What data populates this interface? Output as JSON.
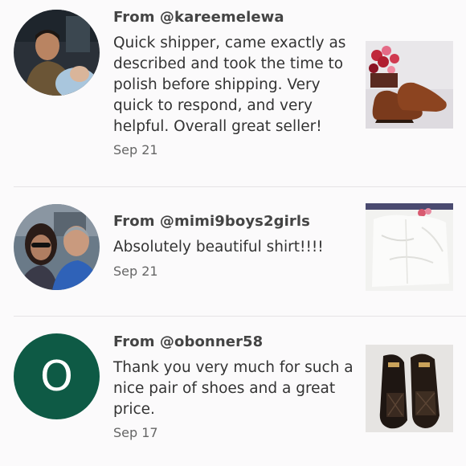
{
  "reviews": [
    {
      "author": "From @kareemelewa",
      "text": "Quick shipper, came exactly as described and took the time to polish before shipping. Very quick to respond, and very helpful. Overall great seller!",
      "date": "Sep 21",
      "avatar_type": "photo",
      "thumbnail": "brown-dress-shoes-photo"
    },
    {
      "author": "From @mimi9boys2girls",
      "text": "Absolutely beautiful shirt!!!!",
      "date": "Sep 21",
      "avatar_type": "photo",
      "thumbnail": "white-shirt-photo"
    },
    {
      "author": "From @obonner58",
      "text": "Thank you very much for such a nice pair of shoes and a great price.",
      "date": "Sep 17",
      "avatar_type": "letter",
      "avatar_letter": "O",
      "avatar_color": "#0e5a45",
      "thumbnail": "black-woven-loafers-photo"
    }
  ]
}
